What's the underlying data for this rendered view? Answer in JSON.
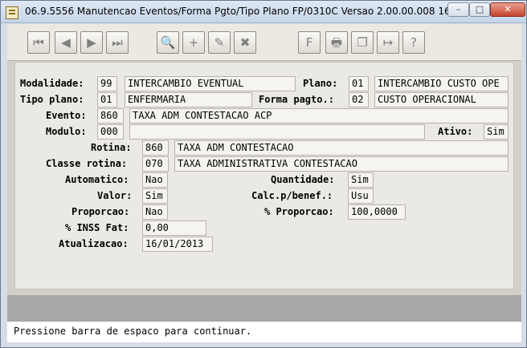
{
  "window": {
    "title": "06.9.5556 Manutencao  Eventos/Forma Pgto/Tipo Plano FP/0310C Versao 2.00.00.008 16/01/20...",
    "min_label": "–",
    "max_label": "□",
    "close_label": "✕"
  },
  "toolbar": {
    "first": "⏮",
    "prev": "◀",
    "next": "▶",
    "last": "⏭",
    "search": "🔍",
    "add": "+",
    "edit": "✎",
    "delete": "✖",
    "filter": "F",
    "print": "🖶",
    "copy": "❐",
    "exit": "↦",
    "help": "?"
  },
  "form": {
    "modalidade": {
      "label": "Modalidade:",
      "code": "99",
      "desc": "INTERCAMBIO EVENTUAL"
    },
    "plano": {
      "label": "Plano:",
      "code": "01",
      "desc": "INTERCAMBIO CUSTO OPE"
    },
    "tipo_plano": {
      "label": "Tipo plano:",
      "code": "01",
      "desc": "ENFERMARIA"
    },
    "forma_pagto": {
      "label": "Forma pagto.:",
      "code": "02",
      "desc": "CUSTO OPERACIONAL"
    },
    "evento": {
      "label": "Evento:",
      "code": "860",
      "desc": "TAXA ADM CONTESTACAO ACP"
    },
    "modulo": {
      "label": "Modulo:",
      "code": "000",
      "desc": ""
    },
    "ativo": {
      "label": "Ativo:",
      "value": "Sim"
    },
    "rotina": {
      "label": "Rotina:",
      "code": "860",
      "desc": "TAXA ADM CONTESTACAO"
    },
    "classe_rotina": {
      "label": "Classe rotina:",
      "code": "070",
      "desc": "TAXA ADMINISTRATIVA CONTESTACAO"
    },
    "automatico": {
      "label": "Automatico:",
      "value": "Nao"
    },
    "quantidade": {
      "label": "Quantidade:",
      "value": "Sim"
    },
    "valor": {
      "label": "Valor:",
      "value": "Sim"
    },
    "calc_benef": {
      "label": "Calc.p/benef.:",
      "value": "Usu"
    },
    "proporcao": {
      "label": "Proporcao:",
      "value": "Nao"
    },
    "pct_proporcao": {
      "label": "% Proporcao:",
      "value": "100,0000"
    },
    "pct_inss_fat": {
      "label": "% INSS Fat:",
      "value": "0,00"
    },
    "atualizacao": {
      "label": "Atualizacao:",
      "value": "16/01/2013"
    }
  },
  "status": {
    "message": "Pressione barra de espaco para continuar."
  }
}
